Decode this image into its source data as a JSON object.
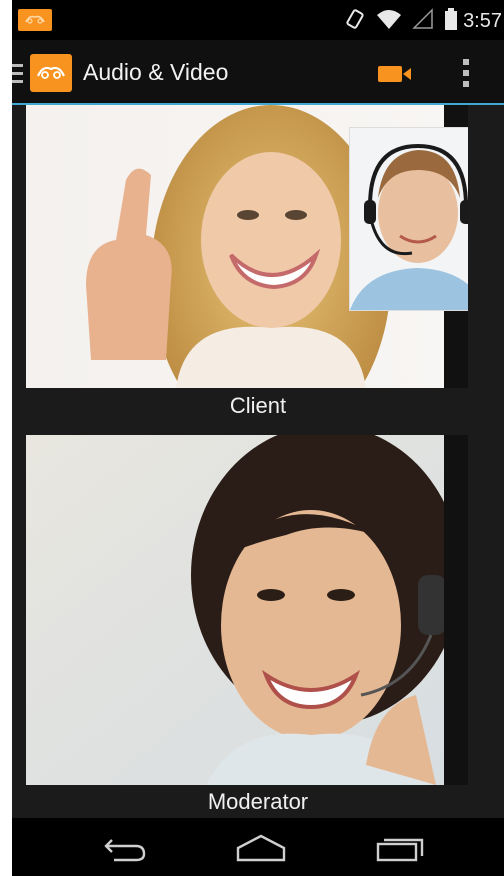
{
  "status_bar": {
    "time": "3:57",
    "icons": [
      "app-notification-icon",
      "rotation-icon",
      "wifi-icon",
      "signal-icon",
      "battery-icon"
    ]
  },
  "action_bar": {
    "title": "Audio & Video",
    "icons": [
      "drawer-icon",
      "app-logo-icon",
      "video-camera-icon",
      "overflow-menu-icon"
    ]
  },
  "video_tiles": [
    {
      "caption": "Client",
      "has_self_view_pip": true
    },
    {
      "caption": "Moderator",
      "has_self_view_pip": false
    }
  ],
  "nav_bar": {
    "icons": [
      "back-icon",
      "home-icon",
      "recent-apps-icon"
    ]
  },
  "colors": {
    "accent": "#f7931e",
    "divider": "#3fa9d4",
    "background": "#1b1b1b"
  }
}
